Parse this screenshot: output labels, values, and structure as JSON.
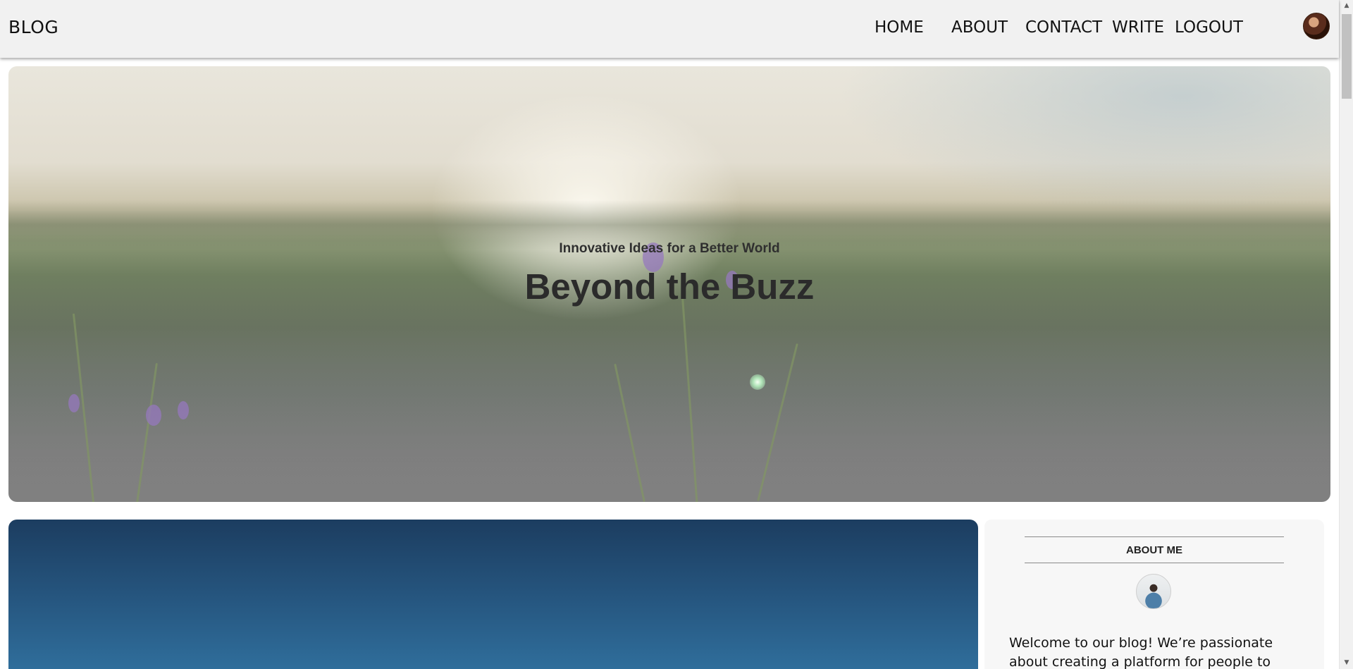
{
  "brand": "BLOG",
  "nav": {
    "home": "HOME",
    "about": "ABOUT",
    "contact": "CONTACT",
    "write": "WRITE",
    "logout": "LOGOUT"
  },
  "hero": {
    "subtitle": "Innovative Ideas for a Better World",
    "title": "Beyond the Buzz"
  },
  "sidebar": {
    "title": "ABOUT ME",
    "text": "Welcome to our blog! We’re passionate about creating a platform for people to"
  },
  "scrollbar": {
    "up_arrow": "▲",
    "down_arrow": "▼"
  }
}
